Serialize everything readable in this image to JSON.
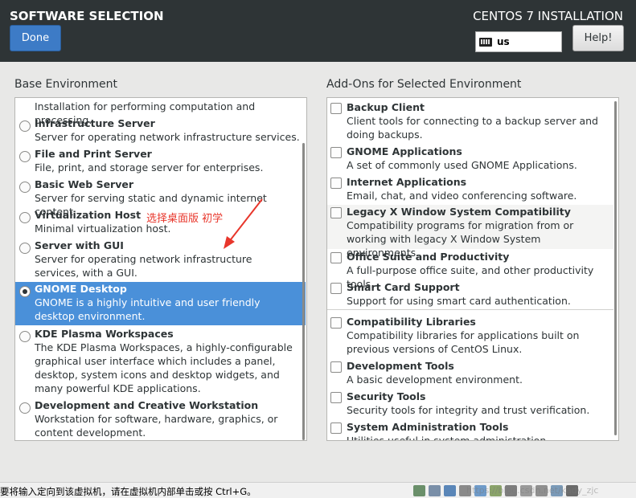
{
  "header": {
    "title": "SOFTWARE SELECTION",
    "install_title": "CENTOS 7 INSTALLATION",
    "done_label": "Done",
    "keyboard_layout": "us",
    "help_label": "Help!"
  },
  "base_env": {
    "heading": "Base Environment",
    "items": [
      {
        "name": "",
        "desc": "Installation for performing computation and processing.",
        "selected": false
      },
      {
        "name": "Infrastructure Server",
        "desc": "Server for operating network infrastructure services.",
        "selected": false
      },
      {
        "name": "File and Print Server",
        "desc": "File, print, and storage server for enterprises.",
        "selected": false
      },
      {
        "name": "Basic Web Server",
        "desc": "Server for serving static and dynamic internet content.",
        "selected": false
      },
      {
        "name": "Virtualization Host",
        "desc": "Minimal virtualization host.",
        "selected": false
      },
      {
        "name": "Server with GUI",
        "desc": "Server for operating network infrastructure services, with a GUI.",
        "selected": false
      },
      {
        "name": "GNOME Desktop",
        "desc": "GNOME is a highly intuitive and user friendly desktop environment.",
        "selected": true
      },
      {
        "name": "KDE Plasma Workspaces",
        "desc": "The KDE Plasma Workspaces, a highly-configurable graphical user interface which includes a panel, desktop, system icons and desktop widgets, and many powerful KDE applications.",
        "selected": false
      },
      {
        "name": "Development and Creative Workstation",
        "desc": "Workstation for software, hardware, graphics, or content development.",
        "selected": false
      }
    ]
  },
  "addons": {
    "heading": "Add-Ons for Selected Environment",
    "items": [
      {
        "name": "Backup Client",
        "desc": "Client tools for connecting to a backup server and doing backups."
      },
      {
        "name": "GNOME Applications",
        "desc": "A set of commonly used GNOME Applications."
      },
      {
        "name": "Internet Applications",
        "desc": "Email, chat, and video conferencing software."
      },
      {
        "name": "Legacy X Window System Compatibility",
        "desc": "Compatibility programs for migration from or working with legacy X Window System environments."
      },
      {
        "name": "Office Suite and Productivity",
        "desc": "A full-purpose office suite, and other productivity tools."
      },
      {
        "name": "Smart Card Support",
        "desc": "Support for using smart card authentication."
      },
      {
        "name": "Compatibility Libraries",
        "desc": "Compatibility libraries for applications built on previous versions of CentOS Linux."
      },
      {
        "name": "Development Tools",
        "desc": "A basic development environment."
      },
      {
        "name": "Security Tools",
        "desc": "Security tools for integrity and trust verification."
      },
      {
        "name": "System Administration Tools",
        "desc": "Utilities useful in system administration."
      }
    ]
  },
  "annotation": {
    "text": "选择桌面版  初学",
    "color": "#e8362b"
  },
  "statusbar": {
    "message": "要将输入定向到该虚拟机，请在虚拟机内部单击或按 Ctrl+G。",
    "watermark": "https://blog.csdn.net/kady_zjc"
  },
  "colors": {
    "header_bg": "#2e3436",
    "accent": "#3d7bc6",
    "selection": "#4a90d9"
  }
}
